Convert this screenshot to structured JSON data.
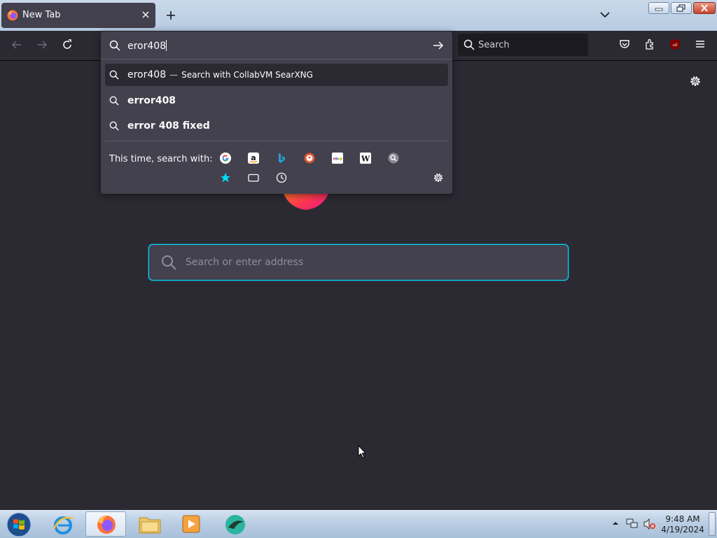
{
  "tab": {
    "title": "New Tab",
    "close_icon": "close-icon",
    "icon": "firefox-icon"
  },
  "toolbar": {
    "back_icon": "arrow-left-icon",
    "forward_icon": "arrow-right-icon",
    "reload_icon": "reload-icon",
    "search_placeholder": "Search",
    "icons": [
      "pocket-icon",
      "extensions-icon",
      "ublock-icon",
      "menu-icon"
    ]
  },
  "urlbar": {
    "value": "eror408",
    "go_icon": "arrow-right-icon",
    "suggestions": [
      {
        "query": "eror408",
        "dash": "—",
        "action": "Search with CollabVM SearXNG",
        "selected": true
      },
      {
        "query": "error408",
        "selected": false
      },
      {
        "query": "error 408 fixed",
        "selected": false
      }
    ],
    "oneoff_label": "This time, search with:",
    "engines": [
      "Google",
      "Amazon",
      "Bing",
      "DuckDuckGo",
      "eBay",
      "Wikipedia",
      "CollabVM SearXNG"
    ],
    "modes": [
      "bookmarks-icon",
      "tabs-icon",
      "history-icon"
    ]
  },
  "home": {
    "search_placeholder": "Search or enter address"
  },
  "colors": {
    "accent": "#00ddff",
    "bg": "#2b2a33",
    "panel": "#42414d"
  },
  "taskbar": {
    "apps": [
      "internet-explorer-icon",
      "firefox-icon",
      "file-explorer-icon",
      "media-player-icon",
      "app-icon"
    ],
    "time": "9:48 AM",
    "date": "4/19/2024"
  }
}
